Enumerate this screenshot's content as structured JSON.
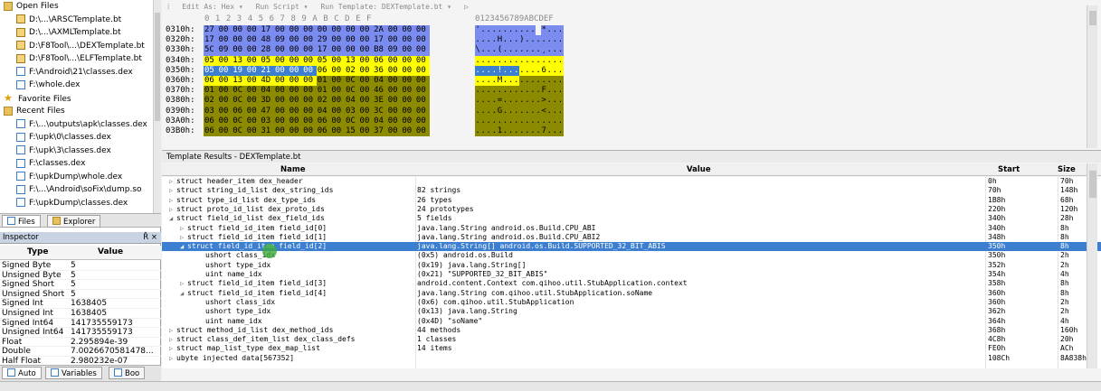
{
  "file_tree": {
    "open_files_label": "Open Files",
    "open_files": [
      "D:\\...\\ARSCTemplate.bt",
      "D:\\...\\AXMLTemplate.bt",
      "D:\\F8Tool\\...\\DEXTemplate.bt",
      "D:\\F8Tool\\...\\ELFTemplate.bt",
      "F:\\Android\\21\\classes.dex",
      "F:\\whole.dex"
    ],
    "favorite_files_label": "Favorite Files",
    "recent_files_label": "Recent Files",
    "recent_files": [
      "F:\\...\\outputs\\apk\\classes.dex",
      "F:\\upk\\0\\classes.dex",
      "F:\\upk\\3\\classes.dex",
      "F:\\classes.dex",
      "F:\\upkDump\\whole.dex",
      "F:\\...\\Android\\soFix\\dump.so",
      "F:\\upkDump\\classes.dex"
    ]
  },
  "left_tabs": [
    "Files",
    "Explorer"
  ],
  "inspector": {
    "title": "Inspector",
    "controls": "Ř ×",
    "col_type": "Type",
    "col_value": "Value",
    "rows": [
      {
        "type": "Signed Byte",
        "value": "5"
      },
      {
        "type": "Unsigned Byte",
        "value": "5"
      },
      {
        "type": "Signed Short",
        "value": "5"
      },
      {
        "type": "Unsigned Short",
        "value": "5"
      },
      {
        "type": "Signed Int",
        "value": "1638405"
      },
      {
        "type": "Unsigned Int",
        "value": "1638405"
      },
      {
        "type": "Signed Int64",
        "value": "141735559173"
      },
      {
        "type": "Unsigned Int64",
        "value": "141735559173"
      },
      {
        "type": "Float",
        "value": "2.295894e-39"
      },
      {
        "type": "Double",
        "value": "7.0026670581478..."
      },
      {
        "type": "Half Float",
        "value": "2.980232e-07"
      }
    ]
  },
  "bottom_tabs": [
    "Auto",
    "Variables",
    "Boo"
  ],
  "hex_toolbar": {
    "edit_as": "Edit As: Hex ▾",
    "run_script": "Run Script ▾",
    "run_template": "Run Template: DEXTemplate.bt ▾",
    "play": "▷"
  },
  "hex_header": "0  1  2  3  4  5  6  7  8  9  A  B  C  D  E  F",
  "ascii_header": "0123456789ABCDEF",
  "hex_rows": [
    {
      "addr": "0310h:",
      "bytes": [
        "27",
        "00",
        "00",
        "00",
        "17",
        "00",
        "00",
        "00",
        "00",
        "00",
        "00",
        "00",
        "2A",
        "00",
        "00",
        "00"
      ],
      "ascii": "'.......... *..."
    },
    {
      "addr": "0320h:",
      "bytes": [
        "17",
        "00",
        "00",
        "00",
        "48",
        "09",
        "00",
        "00",
        "29",
        "00",
        "00",
        "00",
        "17",
        "00",
        "00",
        "00"
      ],
      "ascii": "....H...)......."
    },
    {
      "addr": "0330h:",
      "bytes": [
        "5C",
        "09",
        "00",
        "00",
        "28",
        "00",
        "00",
        "00",
        "17",
        "00",
        "00",
        "00",
        "B8",
        "09",
        "00",
        "00"
      ],
      "ascii": "\\...(.......¸..."
    },
    {
      "addr": "0340h:",
      "bytes": [
        "05",
        "00",
        "13",
        "00",
        "05",
        "00",
        "00",
        "00",
        "05",
        "00",
        "13",
        "00",
        "06",
        "00",
        "00",
        "00"
      ],
      "ascii": "................"
    },
    {
      "addr": "0350h:",
      "bytes": [
        "05",
        "00",
        "19",
        "00",
        "21",
        "00",
        "00",
        "00",
        "06",
        "00",
        "02",
        "00",
        "36",
        "00",
        "00",
        "00"
      ],
      "ascii": "....!.......6..."
    },
    {
      "addr": "0360h:",
      "bytes": [
        "06",
        "00",
        "13",
        "00",
        "4D",
        "00",
        "00",
        "00",
        "01",
        "00",
        "0C",
        "00",
        "04",
        "00",
        "00",
        "00"
      ],
      "ascii": "....M..........."
    },
    {
      "addr": "0370h:",
      "bytes": [
        "01",
        "00",
        "0C",
        "00",
        "04",
        "00",
        "00",
        "00",
        "01",
        "00",
        "0C",
        "00",
        "46",
        "00",
        "00",
        "00"
      ],
      "ascii": "............F..."
    },
    {
      "addr": "0380h:",
      "bytes": [
        "02",
        "00",
        "0C",
        "00",
        "3D",
        "00",
        "00",
        "00",
        "02",
        "00",
        "04",
        "00",
        "3E",
        "00",
        "00",
        "00"
      ],
      "ascii": "....=.......>..."
    },
    {
      "addr": "0390h:",
      "bytes": [
        "03",
        "00",
        "06",
        "00",
        "47",
        "00",
        "00",
        "00",
        "04",
        "00",
        "03",
        "00",
        "3C",
        "00",
        "00",
        "00"
      ],
      "ascii": "....G.......<..."
    },
    {
      "addr": "03A0h:",
      "bytes": [
        "06",
        "00",
        "0C",
        "00",
        "03",
        "00",
        "00",
        "00",
        "06",
        "00",
        "0C",
        "00",
        "04",
        "00",
        "00",
        "00"
      ],
      "ascii": "................"
    },
    {
      "addr": "03B0h:",
      "bytes": [
        "06",
        "00",
        "0C",
        "00",
        "31",
        "00",
        "00",
        "00",
        "06",
        "00",
        "15",
        "00",
        "37",
        "00",
        "00",
        "00"
      ],
      "ascii": "....1.......7..."
    }
  ],
  "template": {
    "title": "Template Results - DEXTemplate.bt",
    "col_name": "Name",
    "col_value": "Value",
    "col_start": "Start",
    "col_size": "Size",
    "rows": [
      {
        "name": "struct header_item dex_header",
        "value": "",
        "start": "0h",
        "size": "70h",
        "tri": "▷",
        "indent": 0,
        "sel": false
      },
      {
        "name": "struct string_id_list dex_string_ids",
        "value": "82 strings",
        "start": "70h",
        "size": "148h",
        "tri": "▷",
        "indent": 0,
        "sel": false
      },
      {
        "name": "struct type_id_list dex_type_ids",
        "value": "26 types",
        "start": "1B8h",
        "size": "68h",
        "tri": "▷",
        "indent": 0,
        "sel": false
      },
      {
        "name": "struct proto_id_list dex_proto_ids",
        "value": "24 prototypes",
        "start": "220h",
        "size": "120h",
        "tri": "▷",
        "indent": 0,
        "sel": false
      },
      {
        "name": "struct field_id_list dex_field_ids",
        "value": "5 fields",
        "start": "340h",
        "size": "28h",
        "tri": "◢",
        "indent": 0,
        "sel": false
      },
      {
        "name": "struct field_id_item field_id[0]",
        "value": "java.lang.String android.os.Build.CPU_ABI",
        "start": "340h",
        "size": "8h",
        "tri": "▷",
        "indent": 1,
        "sel": false
      },
      {
        "name": "struct field_id_item field_id[1]",
        "value": "java.lang.String android.os.Build.CPU_ABI2",
        "start": "348h",
        "size": "8h",
        "tri": "▷",
        "indent": 1,
        "sel": false
      },
      {
        "name": "struct field_id_item field_id[2]",
        "value": "java.lang.String[] android.os.Build.SUPPORTED_32_BIT_ABIS",
        "start": "350h",
        "size": "8h",
        "tri": "◢",
        "indent": 1,
        "sel": true
      },
      {
        "name": "ushort class_idx",
        "value": "(0x5) android.os.Build",
        "start": "350h",
        "size": "2h",
        "tri": "",
        "indent": 2,
        "sel": false
      },
      {
        "name": "ushort type_idx",
        "value": "(0x19) java.lang.String[]",
        "start": "352h",
        "size": "2h",
        "tri": "",
        "indent": 2,
        "sel": false
      },
      {
        "name": "uint name_idx",
        "value": "(0x21) \"SUPPORTED_32_BIT_ABIS\"",
        "start": "354h",
        "size": "4h",
        "tri": "",
        "indent": 2,
        "sel": false
      },
      {
        "name": "struct field_id_item field_id[3]",
        "value": "android.content.Context com.qihoo.util.StubApplication.context",
        "start": "358h",
        "size": "8h",
        "tri": "▷",
        "indent": 1,
        "sel": false
      },
      {
        "name": "struct field_id_item field_id[4]",
        "value": "java.lang.String com.qihoo.util.StubApplication.soName",
        "start": "360h",
        "size": "8h",
        "tri": "◢",
        "indent": 1,
        "sel": false
      },
      {
        "name": "ushort class_idx",
        "value": "(0x6) com.qihoo.util.StubApplication",
        "start": "360h",
        "size": "2h",
        "tri": "",
        "indent": 2,
        "sel": false
      },
      {
        "name": "ushort type_idx",
        "value": "(0x13) java.lang.String",
        "start": "362h",
        "size": "2h",
        "tri": "",
        "indent": 2,
        "sel": false
      },
      {
        "name": "uint name_idx",
        "value": "(0x4D) \"soName\"",
        "start": "364h",
        "size": "4h",
        "tri": "",
        "indent": 2,
        "sel": false
      },
      {
        "name": "struct method_id_list dex_method_ids",
        "value": "44 methods",
        "start": "368h",
        "size": "160h",
        "tri": "▷",
        "indent": 0,
        "sel": false
      },
      {
        "name": "struct class_def_item_list dex_class_defs",
        "value": "1 classes",
        "start": "4C8h",
        "size": "20h",
        "tri": "▷",
        "indent": 0,
        "sel": false
      },
      {
        "name": "struct map_list_type dex_map_list",
        "value": "14 items",
        "start": "FE0h",
        "size": "ACh",
        "tri": "▷",
        "indent": 0,
        "sel": false
      },
      {
        "name": "ubyte injected data[567352]",
        "value": "",
        "start": "108Ch",
        "size": "8A838h",
        "tri": "▷",
        "indent": 0,
        "sel": false
      }
    ]
  },
  "colors": {
    "hex_blue": "#7b8cf0",
    "hex_yellow": "#ffff00",
    "hex_olive": "#8c8a00",
    "selection": "#3c7fd0"
  }
}
